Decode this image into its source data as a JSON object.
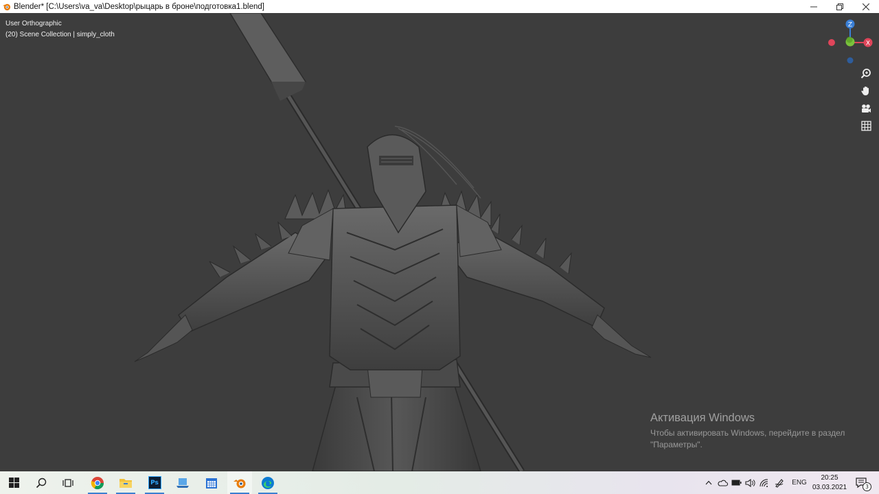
{
  "window": {
    "title": "Blender* [C:\\Users\\va_va\\Desktop\\рыцарь в броне\\подготовка1.blend]",
    "minimize_icon": "minimize-icon",
    "restore_icon": "restore-icon",
    "close_icon": "close-icon"
  },
  "viewport": {
    "view_name": "User Orthographic",
    "collection_info": "(20) Scene Collection | simply_cloth",
    "gizmo": {
      "z_label": "Z",
      "x_label": "X",
      "y_label": "Y"
    },
    "nav_tools": [
      "zoom-icon",
      "pan-hand-icon",
      "camera-icon",
      "grid-icon"
    ]
  },
  "activation": {
    "heading": "Активация Windows",
    "line1": "Чтобы активировать Windows, перейдите в раздел",
    "line2": "\"Параметры\"."
  },
  "taskbar": {
    "apps": [
      "windows-start-icon",
      "search-icon",
      "task-view-icon",
      "chrome-icon",
      "file-explorer-icon",
      "photoshop-icon",
      "laptop-icon",
      "calendar-icon",
      "blender-icon",
      "edge-icon"
    ],
    "photoshop_label": "Ps",
    "language": "ENG",
    "time": "20:25",
    "date": "03.03.2021",
    "notification_count": "3"
  },
  "colors": {
    "viewport_bg": "#3d3d3d",
    "gizmo_x": "#e0455a",
    "gizmo_y": "#7ac23c",
    "gizmo_z": "#3a7fd6"
  }
}
